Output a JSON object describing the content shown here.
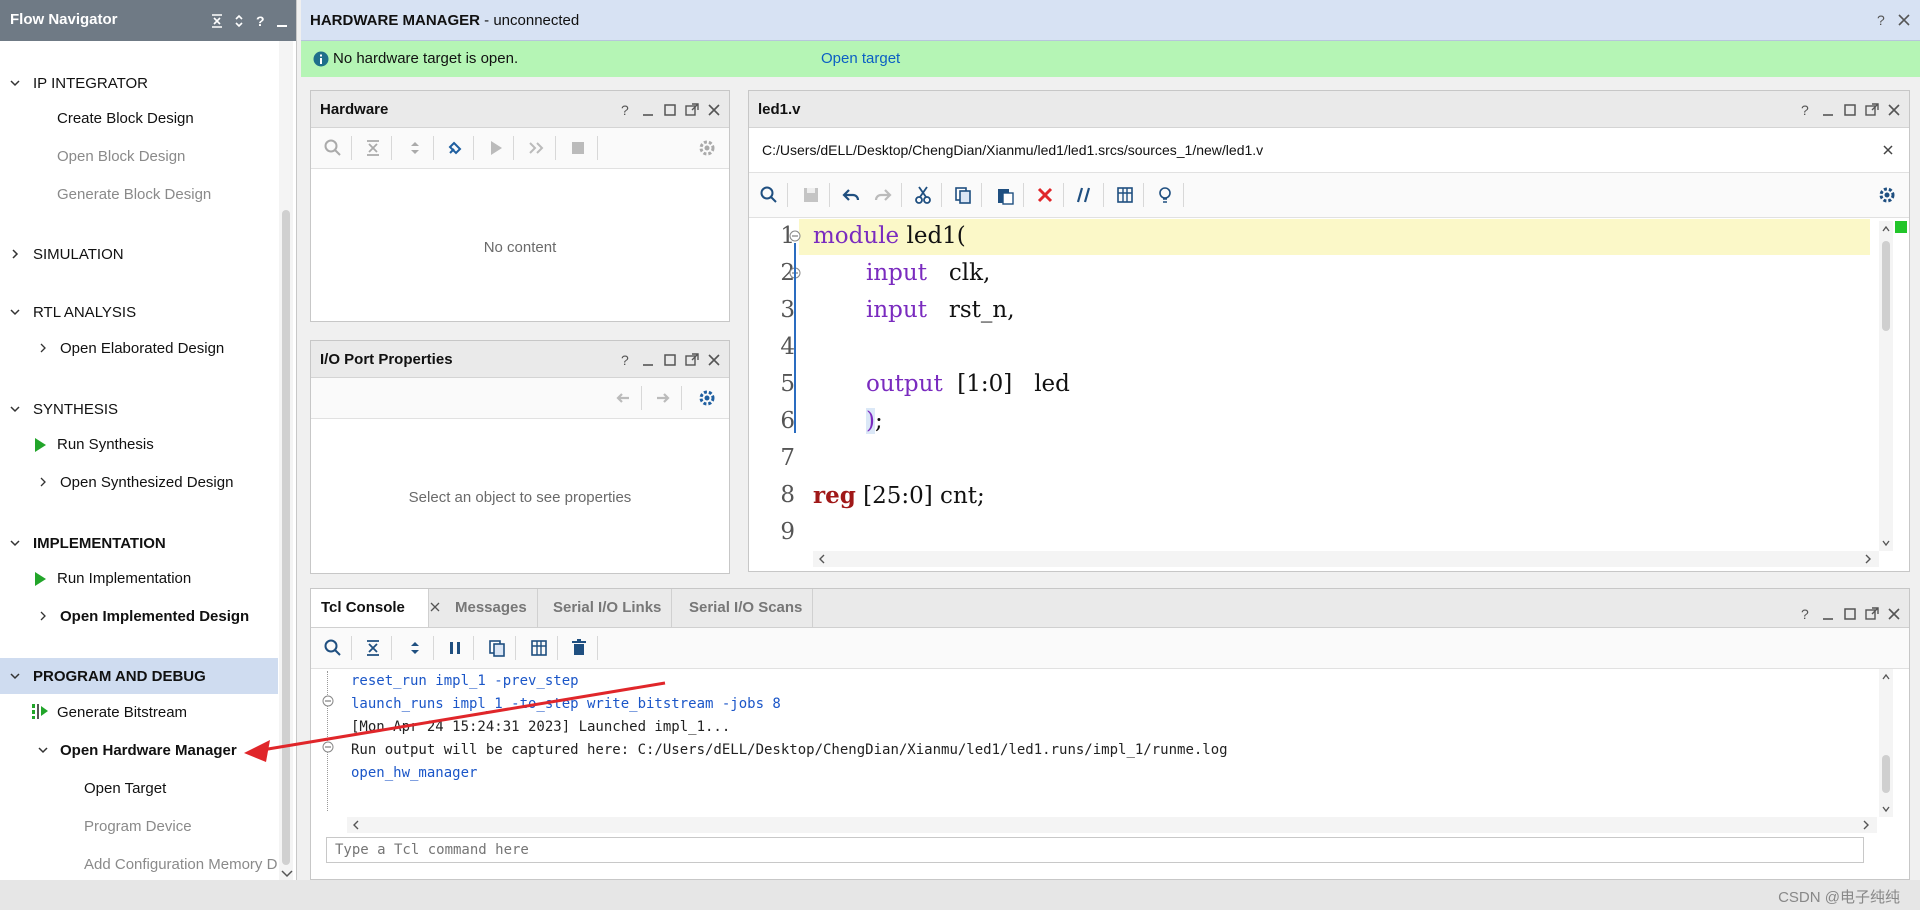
{
  "flow_navigator": {
    "title": "Flow Navigator",
    "sections": {
      "ip_integrator": {
        "label": "IP INTEGRATOR",
        "items": [
          "Create Block Design",
          "Open Block Design",
          "Generate Block Design"
        ]
      },
      "simulation": {
        "label": "SIMULATION"
      },
      "rtl_analysis": {
        "label": "RTL ANALYSIS",
        "items": [
          "Open Elaborated Design"
        ]
      },
      "synthesis": {
        "label": "SYNTHESIS",
        "items": [
          "Run Synthesis",
          "Open Synthesized Design"
        ]
      },
      "implementation": {
        "label": "IMPLEMENTATION",
        "items": [
          "Run Implementation",
          "Open Implemented Design"
        ]
      },
      "program_debug": {
        "label": "PROGRAM AND DEBUG",
        "items": [
          "Generate Bitstream",
          "Open Hardware Manager"
        ],
        "sub_items": [
          "Open Target",
          "Program Device",
          "Add Configuration Memory De"
        ]
      }
    }
  },
  "hardware_manager": {
    "title": "HARDWARE MANAGER",
    "status": " - unconnected"
  },
  "banner": {
    "message": "No hardware target is open.",
    "link": "Open target"
  },
  "hardware_panel": {
    "title": "Hardware",
    "empty": "No content"
  },
  "io_panel": {
    "title": "I/O Port Properties",
    "empty": "Select an object to see properties"
  },
  "editor": {
    "tab_title": "led1.v",
    "path": "C:/Users/dELL/Desktop/ChengDian/Xianmu/led1/led1.srcs/sources_1/new/led1.v",
    "line_numbers": [
      "1",
      "2",
      "3",
      "4",
      "5",
      "6",
      "7",
      "8",
      "9"
    ],
    "lines": {
      "l1a": "module",
      "l1b": " led1(",
      "l2a": "input",
      "l2b": "   clk,",
      "l3a": "input",
      "l3b": "   rst_n,",
      "l5a": "output",
      "l5b": "  [1:0]   led",
      "l6a": ")",
      "l6b": ";",
      "l8a": "reg",
      "l8b": " [25:0] cnt;"
    }
  },
  "tcl_console": {
    "tabs": [
      "Tcl Console",
      "Messages",
      "Serial I/O Links",
      "Serial I/O Scans"
    ],
    "lines": [
      "reset_run impl_1 -prev_step",
      "launch_runs impl_1 -to_step write_bitstream -jobs 8",
      "[Mon Apr 24 15:24:31 2023] Launched impl_1...",
      "Run output will be captured here: C:/Users/dELL/Desktop/ChengDian/Xianmu/led1/led1.runs/impl_1/runme.log",
      "open_hw_manager"
    ],
    "input_placeholder": "Type a Tcl command here"
  },
  "watermark": "CSDN @电子纯纯",
  "colors": {
    "accent_blue": "#0b5fc4",
    "banner_green": "#b5f5b5",
    "header_blue": "#d7e2f3",
    "run_green": "#22a52a",
    "annotation_red": "#e0262a"
  }
}
